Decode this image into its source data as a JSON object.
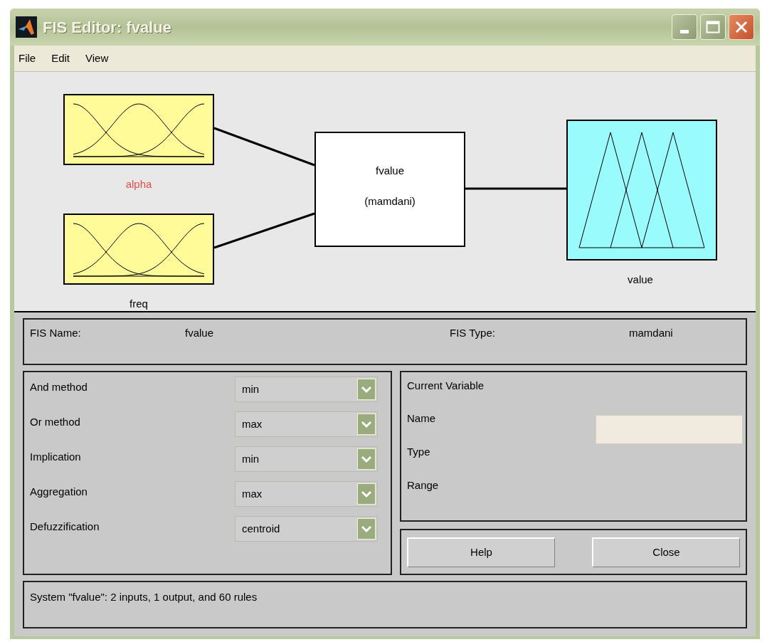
{
  "window": {
    "title": "FIS Editor: fvalue"
  },
  "menu": [
    "File",
    "Edit",
    "View"
  ],
  "diagram": {
    "inputs": [
      {
        "label": "alpha",
        "selected": true
      },
      {
        "label": "freq",
        "selected": false
      }
    ],
    "system": {
      "name": "fvalue",
      "type": "(mamdani)"
    },
    "outputs": [
      {
        "label": "value",
        "selected": false
      }
    ]
  },
  "fis": {
    "name_label": "FIS Name:",
    "name": "fvalue",
    "type_label": "FIS Type:",
    "type": "mamdani"
  },
  "methods": [
    {
      "label": "And method",
      "value": "min"
    },
    {
      "label": "Or method",
      "value": "max"
    },
    {
      "label": "Implication",
      "value": "min"
    },
    {
      "label": "Aggregation",
      "value": "max"
    },
    {
      "label": "Defuzzification",
      "value": "centroid"
    }
  ],
  "current_variable": {
    "title": "Current Variable",
    "fields": [
      "Name",
      "Type",
      "Range"
    ]
  },
  "buttons": [
    "Help",
    "Close"
  ],
  "status": "System \"fvalue\": 2 inputs, 1 output, and 60 rules"
}
